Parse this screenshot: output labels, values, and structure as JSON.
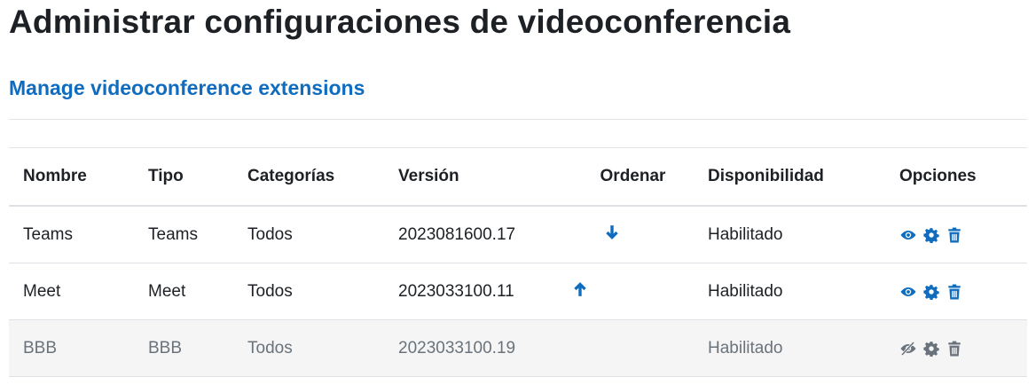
{
  "page": {
    "title": "Administrar configuraciones de videoconferencia",
    "section_link": "Manage videoconference extensions"
  },
  "table": {
    "headers": {
      "name": "Nombre",
      "type": "Tipo",
      "categories": "Categorías",
      "version": "Versión",
      "order": "Ordenar",
      "availability": "Disponibilidad",
      "options": "Opciones"
    },
    "rows": [
      {
        "name": "Teams",
        "type": "Teams",
        "categories": "Todos",
        "version": "2023081600.17",
        "order": "move-down-icon",
        "availability": "Habilitado",
        "enabled": true
      },
      {
        "name": "Meet",
        "type": "Meet",
        "categories": "Todos",
        "version": "2023033100.11",
        "order": "move-up-icon",
        "availability": "Habilitado",
        "enabled": true
      },
      {
        "name": "BBB",
        "type": "BBB",
        "categories": "Todos",
        "version": "2023033100.19",
        "order": "",
        "availability": "Habilitado",
        "enabled": false
      }
    ]
  },
  "colors": {
    "accent": "#0f6cbf",
    "text": "#1d2125",
    "muted": "#6a737b",
    "disabled_row_bg": "#f5f5f5"
  }
}
